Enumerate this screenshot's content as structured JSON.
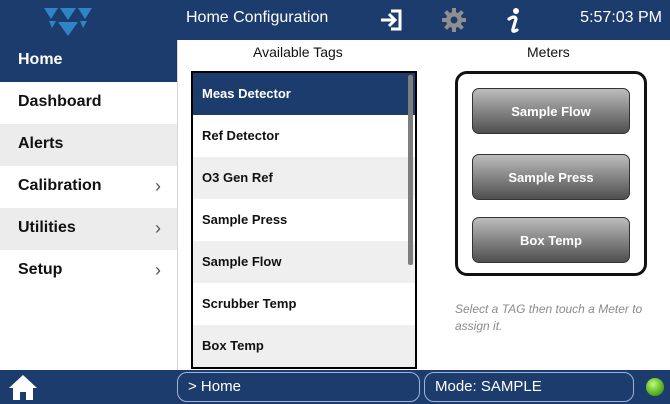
{
  "header": {
    "title": "Home Configuration",
    "time": "5:57:03 PM",
    "icons": [
      "teledyne-logo-icon",
      "login-icon",
      "settings-gear-icon",
      "info-icon"
    ]
  },
  "sidebar": {
    "items": [
      {
        "label": "Home",
        "active": true,
        "has_arrow": false
      },
      {
        "label": "Dashboard",
        "active": false,
        "has_arrow": false
      },
      {
        "label": "Alerts",
        "active": false,
        "has_arrow": false
      },
      {
        "label": "Calibration",
        "active": false,
        "has_arrow": true
      },
      {
        "label": "Utilities",
        "active": false,
        "has_arrow": true
      },
      {
        "label": "Setup",
        "active": false,
        "has_arrow": true
      }
    ],
    "arrow": "›"
  },
  "tags": {
    "heading": "Available Tags",
    "items": [
      "Meas Detector",
      "Ref Detector",
      "O3 Gen Ref",
      "Sample Press",
      "Sample Flow",
      "Scrubber Temp",
      "Box Temp"
    ],
    "selected_index": 0
  },
  "meters": {
    "heading": "Meters",
    "buttons": [
      "Sample Flow",
      "Sample Press",
      "Box Temp"
    ],
    "hint": "Select a TAG then touch a Meter to assign it."
  },
  "footer": {
    "breadcrumb": "> Home",
    "mode": "Mode: SAMPLE",
    "status_color": "#6cc52d"
  },
  "colors": {
    "primary": "#1d3c6e",
    "selected": "#1d3c6e",
    "meter_button": "#6e6e6e"
  }
}
